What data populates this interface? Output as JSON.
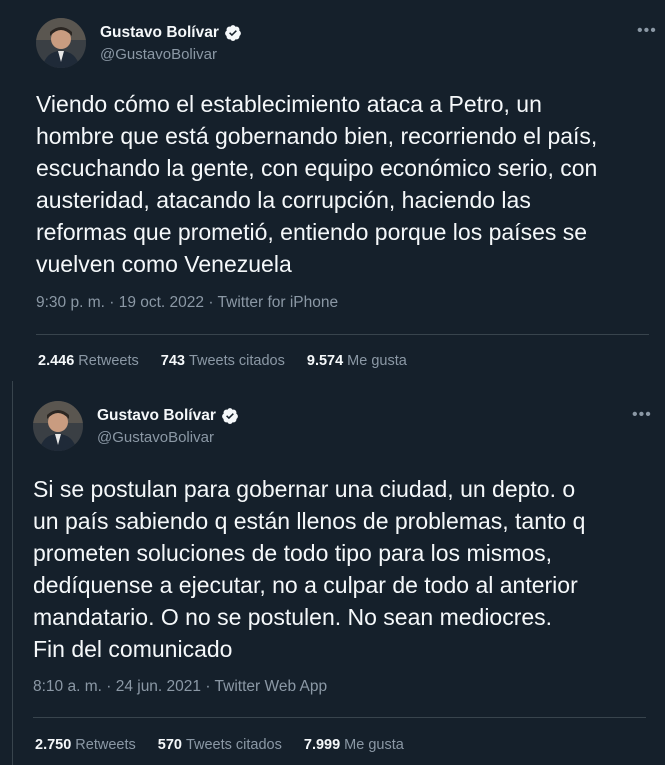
{
  "tweets": [
    {
      "author_name": "Gustavo Bolívar",
      "handle": "@GustavoBolivar",
      "text": "Viendo cómo el establecimiento ataca a Petro, un\nhombre que está gobernando bien, recorriendo el país,\nescuchando la gente, con equipo económico serio, con\nausteridad, atacando la corrupción, haciendo las\nreformas que prometió, entiendo porque los países se\nvuelven como Venezuela",
      "meta": "9:30 p. m. · 19 oct. 2022 · Twitter for iPhone",
      "retweets_count": "2.446",
      "retweets_label": "Retweets",
      "quotes_count": "743",
      "quotes_label": "Tweets citados",
      "likes_count": "9.574",
      "likes_label": "Me gusta"
    },
    {
      "author_name": "Gustavo Bolívar",
      "handle": "@GustavoBolivar",
      "text": "Si se postulan para gobernar una ciudad, un depto. o\nun país sabiendo q están llenos de problemas, tanto q\nprometen soluciones de todo tipo para los mismos,\ndedíquense a ejecutar, no a culpar de todo al anterior\nmandatario. O no se postulen. No sean mediocres.\nFin del comunicado",
      "meta": "8:10 a. m. · 24 jun. 2021 · Twitter Web App",
      "retweets_count": "2.750",
      "retweets_label": "Retweets",
      "quotes_count": "570",
      "quotes_label": "Tweets citados",
      "likes_count": "7.999",
      "likes_label": "Me gusta"
    }
  ],
  "icons": {
    "verified": "verified-badge-icon",
    "more": "more-options-icon"
  },
  "colors": {
    "background": "#15202b",
    "text": "#f5f8fa",
    "secondary": "#8b98a5",
    "divider": "#38444d"
  }
}
